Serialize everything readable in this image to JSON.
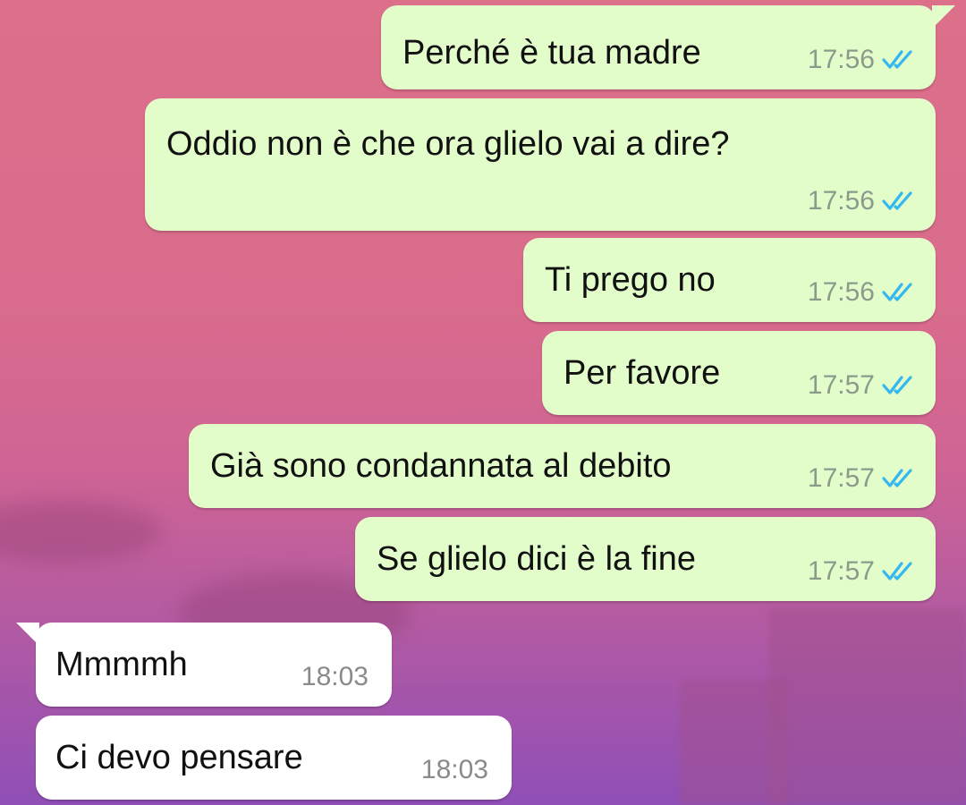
{
  "colors": {
    "outgoing_bubble": "#e2fdca",
    "incoming_bubble": "#ffffff",
    "read_ticks": "#34b7f1",
    "timestamp": "#8c9a8c"
  },
  "messages": [
    {
      "direction": "out",
      "text": "Perché è tua madre",
      "time": "17:56",
      "status_icon": "double-check-read-icon"
    },
    {
      "direction": "out",
      "text": "Oddio non è che ora glielo vai a dire?",
      "time": "17:56",
      "status_icon": "double-check-read-icon"
    },
    {
      "direction": "out",
      "text": "Ti prego no",
      "time": "17:56",
      "status_icon": "double-check-read-icon"
    },
    {
      "direction": "out",
      "text": "Per favore",
      "time": "17:57",
      "status_icon": "double-check-read-icon"
    },
    {
      "direction": "out",
      "text": "Già sono condannata al debito",
      "time": "17:57",
      "status_icon": "double-check-read-icon"
    },
    {
      "direction": "out",
      "text": "Se glielo dici è la fine",
      "time": "17:57",
      "status_icon": "double-check-read-icon"
    },
    {
      "direction": "in",
      "text": "Mmmmh",
      "time": "18:03"
    },
    {
      "direction": "in",
      "text": "Ci devo pensare",
      "time": "18:03"
    }
  ]
}
